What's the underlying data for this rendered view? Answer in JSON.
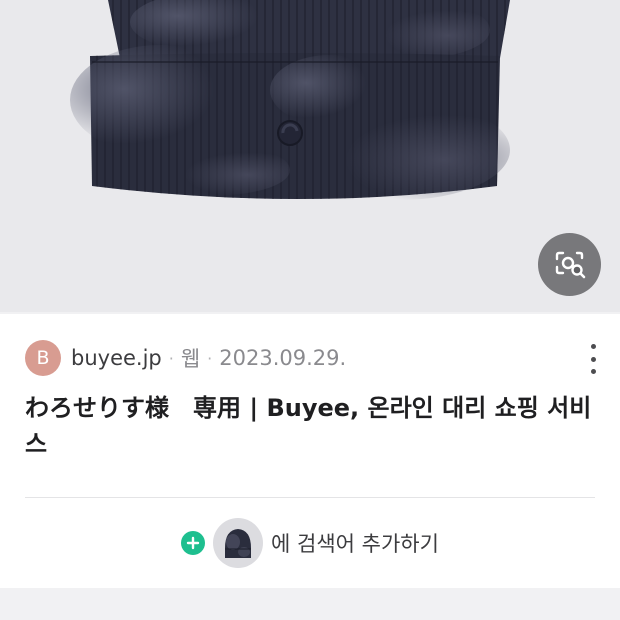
{
  "image": {
    "description_icon": "lens-search-icon"
  },
  "result": {
    "favicon_letter": "B",
    "domain": "buyee.jp",
    "separator": "·",
    "type": "웹",
    "date": "2023.09.29.",
    "title": "わろせりす様　専用 | Buyee, 온라인 대리 쇼핑 서비스",
    "more_icon": "more-vertical-icon"
  },
  "add_search": {
    "plus_icon": "plus-icon",
    "label": "에 검색어 추가하기"
  },
  "colors": {
    "favicon_bg": "#d89c91",
    "plus_bg": "#1ebf8f",
    "beanie": "#2a2d3d"
  }
}
